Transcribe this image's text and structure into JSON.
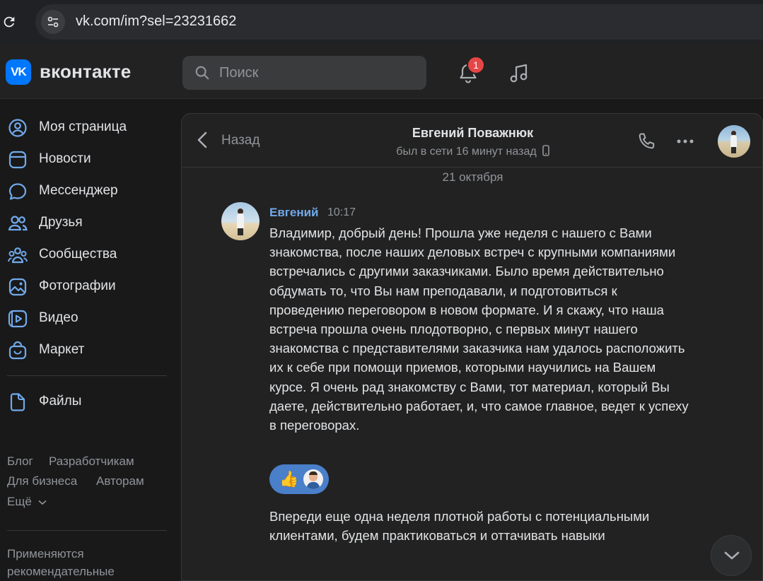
{
  "browser": {
    "url": "vk.com/im?sel=23231662",
    "reload_icon": "reload-icon",
    "site_info_icon": "tune-icon"
  },
  "header": {
    "logo_text": "VK",
    "brand": "вконтакте",
    "search_placeholder": "Поиск",
    "notifications_count": "1",
    "accent_color": "#0077ff"
  },
  "sidebar": {
    "items": [
      {
        "label": "Моя страница",
        "icon": "user-circle-icon"
      },
      {
        "label": "Новости",
        "icon": "news-icon"
      },
      {
        "label": "Мессенджер",
        "icon": "chat-bubble-icon"
      },
      {
        "label": "Друзья",
        "icon": "friends-icon"
      },
      {
        "label": "Сообщества",
        "icon": "communities-icon"
      },
      {
        "label": "Фотографии",
        "icon": "photo-icon"
      },
      {
        "label": "Видео",
        "icon": "video-icon"
      },
      {
        "label": "Маркет",
        "icon": "bag-icon"
      }
    ],
    "files_label": "Файлы",
    "footer": {
      "blog": "Блог",
      "developers": "Разработчикам",
      "business": "Для бизнеса",
      "authors": "Авторам",
      "more": "Ещё"
    },
    "notice_line1": "Применяются",
    "notice_line2": "рекомендательные"
  },
  "chat": {
    "back_label": "Назад",
    "peer_name": "Евгений Поважнюк",
    "peer_status": "был в сети 16 минут назад",
    "date_separator": "21 октября",
    "messages": [
      {
        "author": "Евгений",
        "time": "10:17",
        "text": "Владимир, добрый день! Прошла уже неделя с нашего с Вами знакомства, после наших деловых встреч с крупными компаниями встречались с другими заказчиками. Было время действительно обдумать то, что Вы нам преподавали, и подготовиться к проведению переговором в новом формате. И я скажу, что наша встреча прошла очень плодотворно, с первых минут нашего знакомства с представителями заказчика нам удалось расположить их к себе при помощи приемов, которыми научились на Вашем курсе. Я очень рад знакомству с Вами, тот материал, который Вы даете, действительно работает, и, что самое главное, ведет к успеху в переговорах.",
        "reaction": "👍"
      },
      {
        "text": "Впереди еще одна неделя плотной работы с потенциальными клиентами, будем практиковаться и оттачивать навыки"
      }
    ]
  }
}
